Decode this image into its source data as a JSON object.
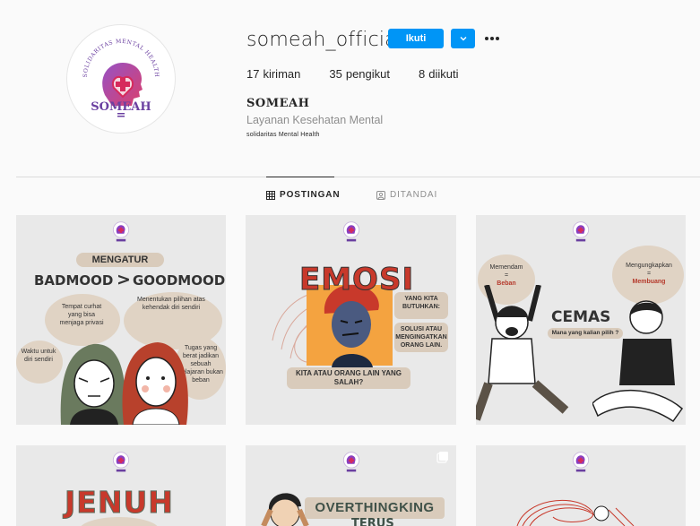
{
  "profile": {
    "username": "someah_official",
    "follow_label": "Ikuti",
    "stats": [
      {
        "num": "17",
        "label": "kiriman"
      },
      {
        "num": "35",
        "label": "pengikut"
      },
      {
        "num": "8",
        "label": "diikuti"
      }
    ],
    "display_name": "SOMEAH",
    "category": "Layanan Kesehatan Mental",
    "bio": "solidaritas Mental Health",
    "logo": {
      "arc_text": "SOLIDARITAS MENTAL HEALTH",
      "word": "SOMEAH"
    }
  },
  "tabs": [
    {
      "label": "POSTINGAN",
      "icon": "grid-icon",
      "active": true
    },
    {
      "label": "DITANDAI",
      "icon": "tag-icon",
      "active": false
    }
  ],
  "posts": [
    {
      "heading": "MENGATUR",
      "title_left": "BADMOOD",
      "title_sep": ">",
      "title_right": "GOODMOOD",
      "notes": [
        "Tempat curhat yang bisa menjaga privasi",
        "Menentukan pilihan atas kehendak diri sendiri",
        "Waktu untuk diri sendiri",
        "Tugas yang berat jadikan sebuah pelajaran bukan beban"
      ]
    },
    {
      "title": "EMOSI",
      "side_heading": "YANG KITA BUTUHKAN:",
      "side_text": "SOLUSI ATAU MENGINGATKAN ORANG LAIN.",
      "bottom": "KITA ATAU ORANG LAIN YANG SALAH?"
    },
    {
      "title": "CEMAS",
      "subtitle": "Mana yang kalian pilih ?",
      "left_note": [
        "Memendam",
        "=",
        "Beban"
      ],
      "right_note": [
        "Mengungkapkan",
        "=",
        "Membuang"
      ]
    },
    {
      "title": "JENUH"
    },
    {
      "title": "OVERTHINGKING",
      "subtitle": "TERUS"
    },
    {
      "title": ""
    }
  ],
  "colors": {
    "accent": "#0095f6",
    "brand_purple": "#6a3fa0",
    "brand_red": "#d32f4b"
  }
}
